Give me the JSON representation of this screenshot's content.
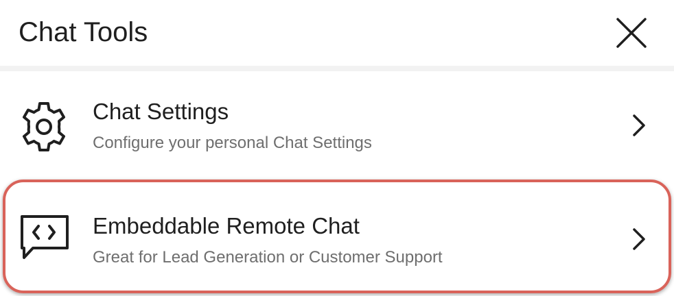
{
  "header": {
    "title": "Chat Tools",
    "close_icon": "close-icon"
  },
  "items": [
    {
      "icon": "gear-icon",
      "title": "Chat Settings",
      "subtitle": "Configure your personal Chat Settings",
      "trailing_icon": "chevron-right-icon",
      "highlighted": false
    },
    {
      "icon": "code-chat-bubble-icon",
      "title": "Embeddable Remote Chat",
      "subtitle": "Great for Lead Generation or Customer Support",
      "trailing_icon": "chevron-right-icon",
      "highlighted": true
    }
  ],
  "colors": {
    "text_primary": "#1f1f1f",
    "text_secondary": "#6e6e6e",
    "divider": "#f2f2f2",
    "highlight_outline": "#d9635a"
  }
}
